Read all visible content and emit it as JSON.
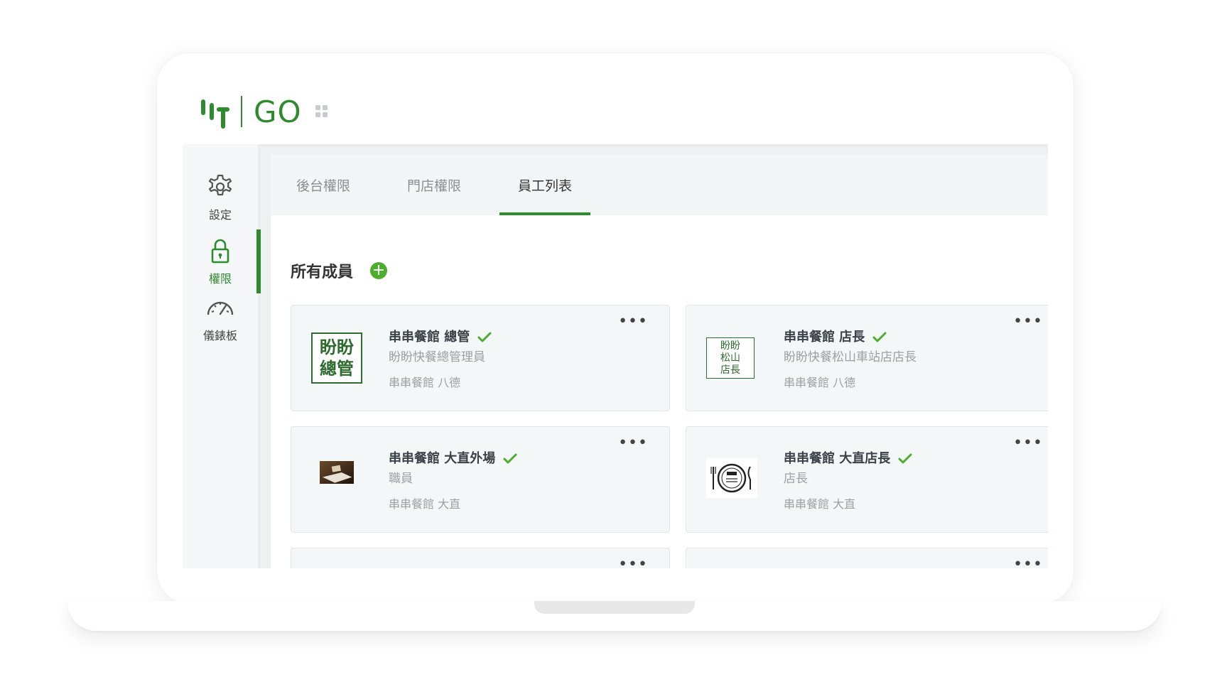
{
  "app": {
    "logo_text": "GO",
    "brand_color": "#2e8b2e",
    "accent_color": "#4cae2c"
  },
  "sidebar": {
    "items": [
      {
        "label": "設定",
        "icon": "gear-icon"
      },
      {
        "label": "權限",
        "icon": "lock-icon",
        "active": true
      },
      {
        "label": "儀錶板",
        "icon": "dashboard-gauge-icon"
      }
    ]
  },
  "tabs": [
    {
      "label": "後台權限"
    },
    {
      "label": "門店權限"
    },
    {
      "label": "員工列表",
      "active": true
    }
  ],
  "section": {
    "title": "所有成員",
    "add_label": "+"
  },
  "members": [
    {
      "name": "串串餐館 總管",
      "role": "盼盼快餐總管理員",
      "store": "串串餐館 八德",
      "avatar_text": [
        "盼盼",
        "總管"
      ],
      "verified": true
    },
    {
      "name": "串串餐館 店長",
      "role": "盼盼快餐松山車站店店長",
      "store": "串串餐館 八德",
      "avatar_text": [
        "盼盼",
        "松山",
        "店長"
      ],
      "verified": true
    },
    {
      "name": "串串餐館 大直外場",
      "role": "職員",
      "store": "串串餐館 大直",
      "avatar_icon": "photo-avatar",
      "verified": true
    },
    {
      "name": "串串餐館 大直店長",
      "role": "店長",
      "store": "串串餐館 大直",
      "avatar_icon": "restaurant-plate-logo",
      "verified": true
    }
  ],
  "more_label": "•••"
}
